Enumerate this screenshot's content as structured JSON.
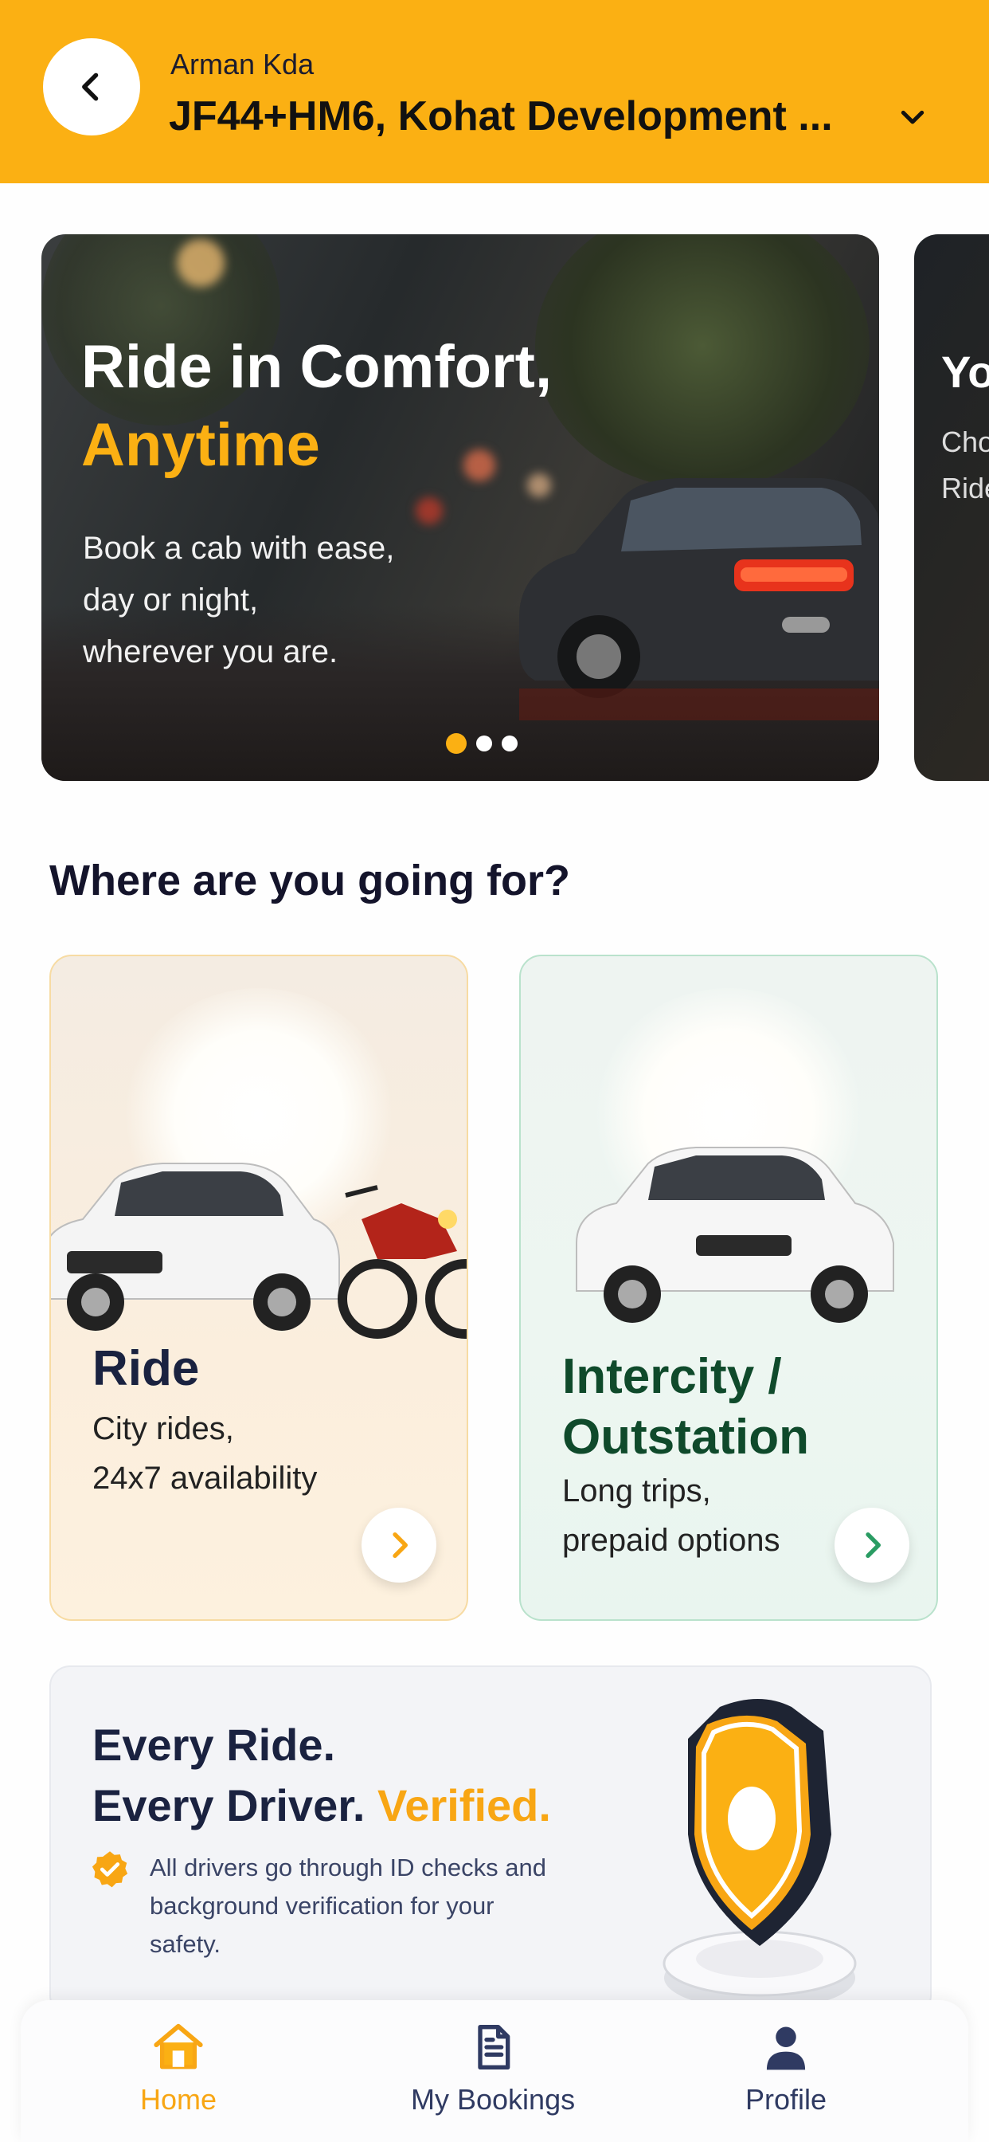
{
  "header": {
    "user_name": "Arman Kda",
    "address": "JF44+HM6, Kohat Development ..."
  },
  "carousel": {
    "slides": [
      {
        "title_line1": "Ride in Comfort,",
        "title_accent": "Anytime",
        "subtitle_lines": [
          "Book a cab with ease,",
          "day or night,",
          "wherever you are."
        ]
      },
      {
        "title": "Yo",
        "subtitle_lines": [
          "Cho",
          "Ride"
        ]
      }
    ],
    "active_index": 0,
    "dot_count": 3
  },
  "section": {
    "heading": "Where are you going for?"
  },
  "cards": {
    "ride": {
      "title": "Ride",
      "desc_line1": "City rides,",
      "desc_line2": "24x7 availability"
    },
    "intercity": {
      "title_line1": "Intercity /",
      "title_line2": "Outstation",
      "desc_line1": "Long trips,",
      "desc_line2": "prepaid options"
    }
  },
  "verified": {
    "line1": "Every Ride.",
    "line2_prefix": "Every Driver. ",
    "line2_accent": "Verified.",
    "text": "All drivers go through ID checks and background verification for your safety."
  },
  "nav": {
    "home": "Home",
    "bookings": "My Bookings",
    "profile": "Profile"
  },
  "colors": {
    "brand_yellow": "#fbb013",
    "accent_orange": "#f8a614",
    "intercity_green": "#0f4a2b",
    "nav_inactive": "#2f3a62"
  },
  "icons": {
    "back": "chevron-left-icon",
    "dropdown": "chevron-down-icon",
    "ride_arrow": "chevron-right-icon",
    "intercity_arrow": "chevron-right-icon",
    "verified": "badge-check-icon",
    "shield": "shield-icon",
    "home": "home-icon",
    "bookings": "document-icon",
    "profile": "user-icon"
  }
}
